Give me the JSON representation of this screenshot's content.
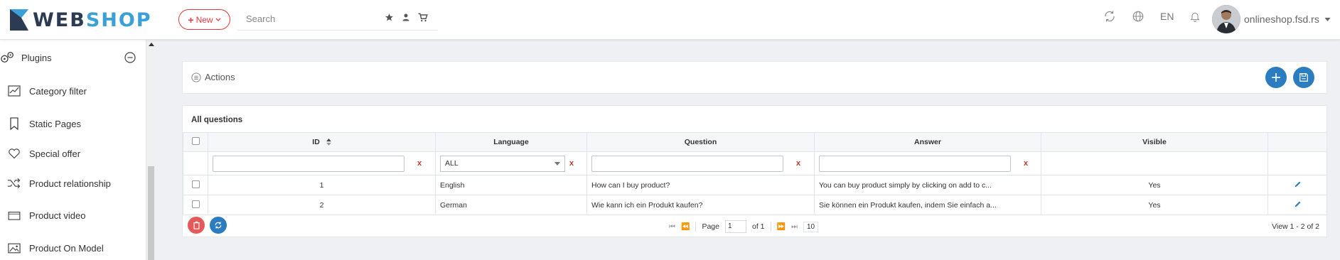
{
  "header": {
    "logo_part1": "WEB",
    "logo_part2": "SHOP",
    "new_button": "New",
    "search_placeholder": "Search",
    "language": "EN",
    "user_name": "onlineshop.fsd.rs"
  },
  "sidebar": {
    "section": "Plugins",
    "items": [
      {
        "label": "Category filter",
        "icon": "chart-icon"
      },
      {
        "label": "Static Pages",
        "icon": "bookmark-icon"
      },
      {
        "label": "Special offer",
        "icon": "heart-icon"
      },
      {
        "label": "Product relationship",
        "icon": "shuffle-icon"
      },
      {
        "label": "Product video",
        "icon": "video-icon"
      },
      {
        "label": "Product On Model",
        "icon": "image-icon"
      }
    ]
  },
  "actions": {
    "title": "Actions"
  },
  "grid": {
    "title": "All questions",
    "columns": [
      "ID",
      "Language",
      "Question",
      "Answer",
      "Visible"
    ],
    "language_filter": "ALL",
    "filter_clear": "x",
    "rows": [
      {
        "id": "1",
        "language": "English",
        "question": "How can I buy product?",
        "answer": "You can buy product simply by clicking on add to c...",
        "visible": "Yes"
      },
      {
        "id": "2",
        "language": "German",
        "question": "Wie kann ich ein Produkt kaufen?",
        "answer": "Sie können ein Produkt kaufen, indem Sie einfach a...",
        "visible": "Yes"
      }
    ],
    "pager": {
      "page_label": "Page",
      "page_value": "1",
      "of_label": "of 1",
      "page_size": "10",
      "view_info": "View 1 - 2 of 2"
    }
  },
  "colors": {
    "accent": "#2b7cc0",
    "danger": "#e03b3b",
    "logo_dark": "#2b3b54",
    "logo_light": "#3aa0d8"
  }
}
